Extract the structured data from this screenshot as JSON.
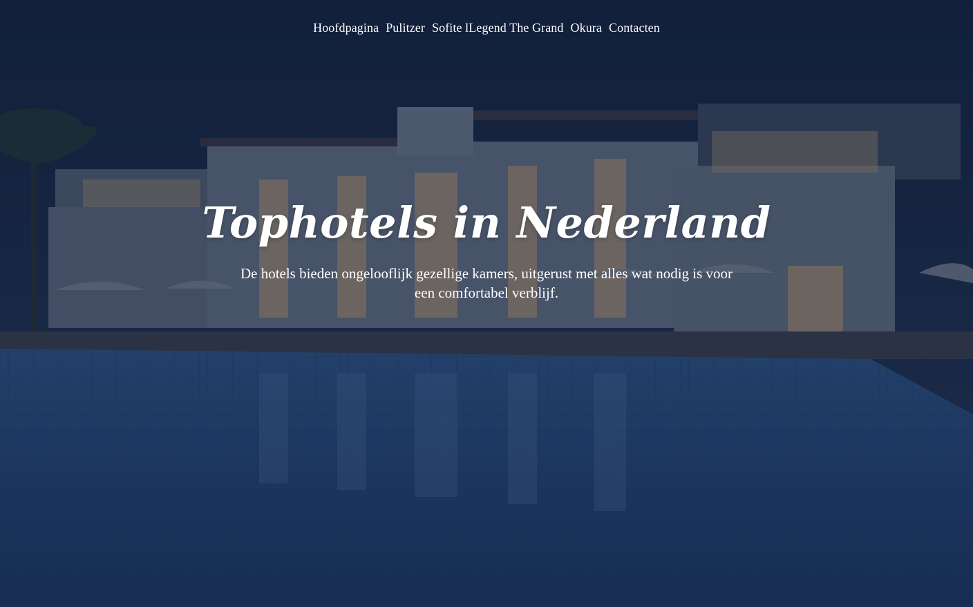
{
  "nav": {
    "items": [
      {
        "label": "Hoofdpagina"
      },
      {
        "label": "Pulitzer"
      },
      {
        "label": "Sofite lLegend The Grand"
      },
      {
        "label": "Okura"
      },
      {
        "label": "Contacten"
      }
    ]
  },
  "hero": {
    "title": "Tophotels in Nederland",
    "subtitle": "De hotels bieden ongelooflijk gezellige kamers, uitgerust met alles wat nodig is voor een comfortabel verblijf."
  },
  "colors": {
    "overlay": "#13233f",
    "text": "#ffffff",
    "pool": "#2b4f8a"
  }
}
